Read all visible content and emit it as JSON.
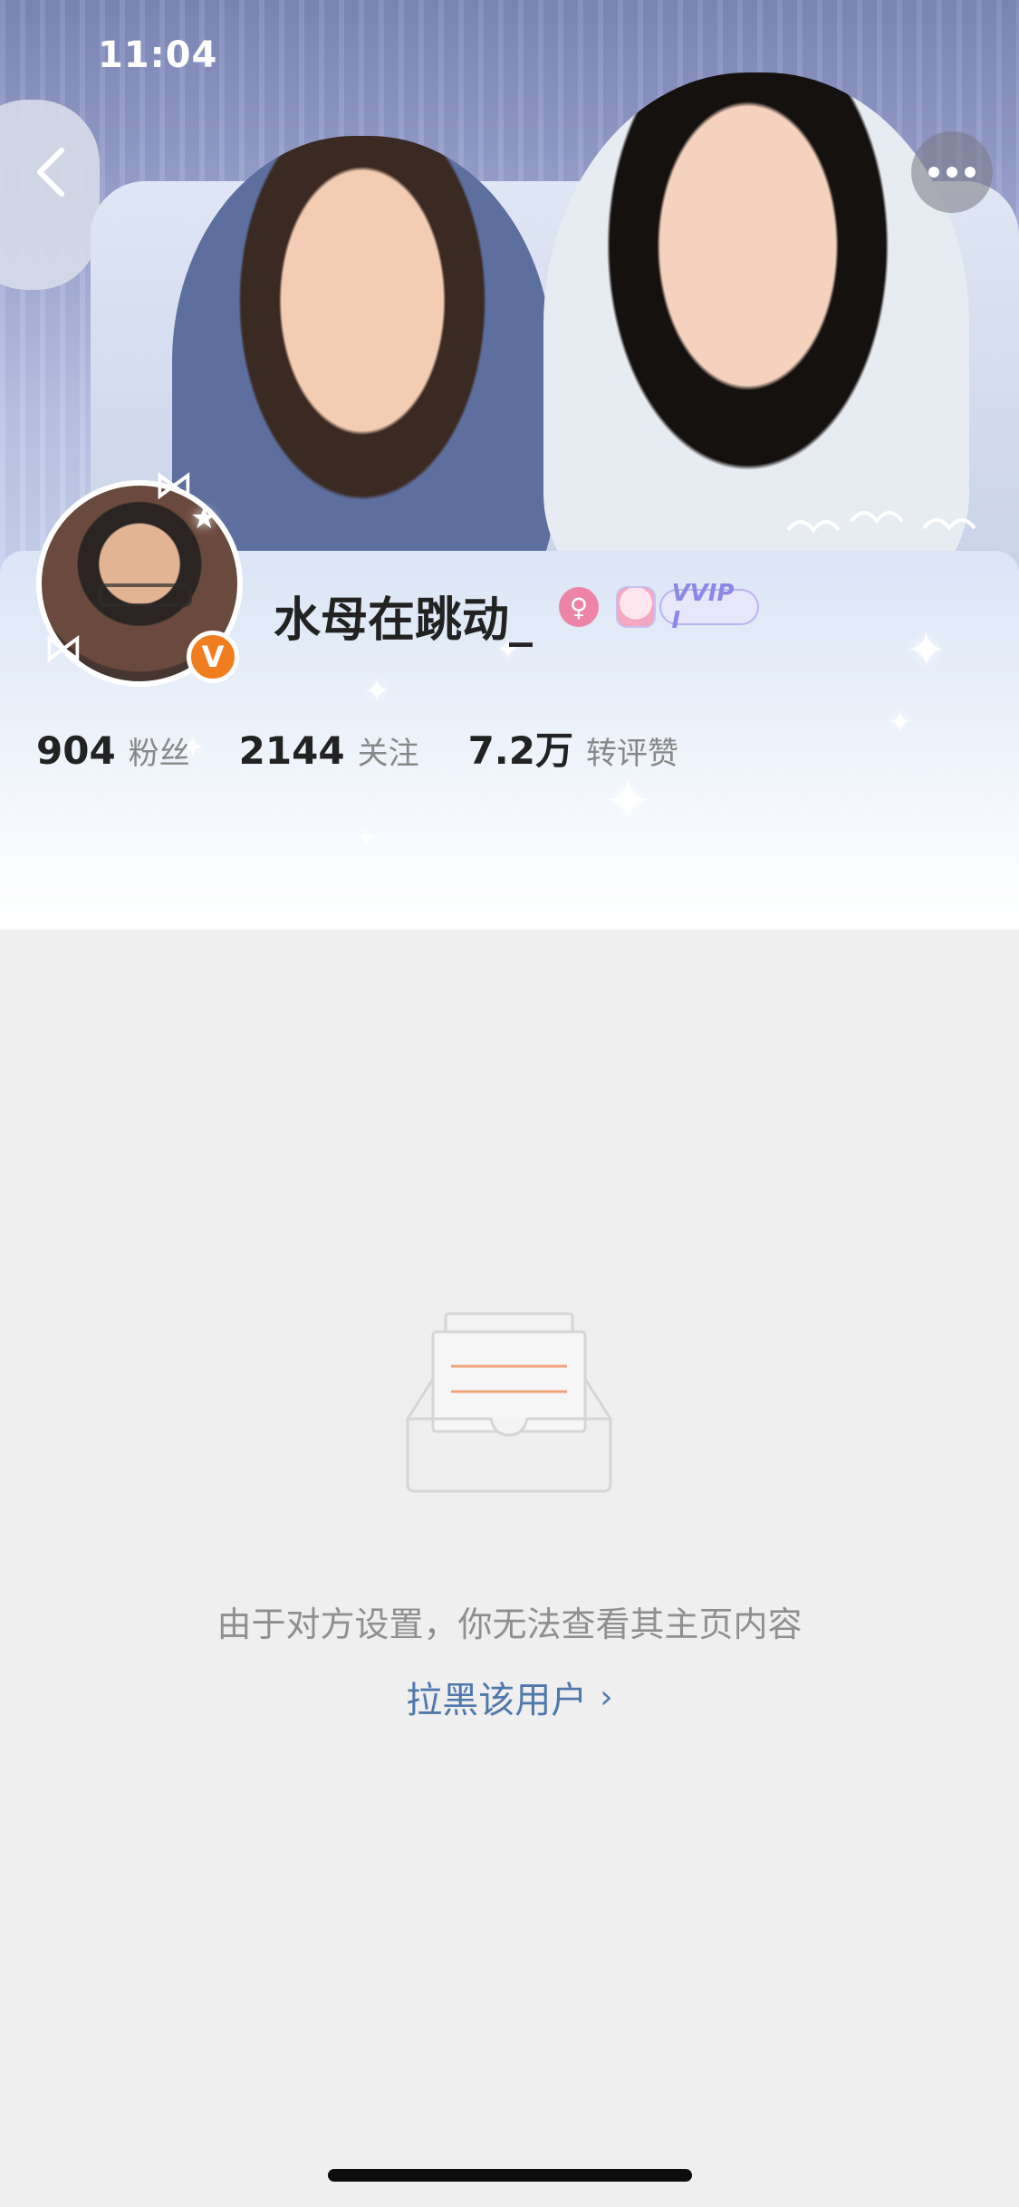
{
  "status_bar": {
    "time": "11:04"
  },
  "nav": {
    "back_icon": "chevron-left-icon",
    "more_icon": "ellipsis-icon"
  },
  "profile": {
    "username": "水母在跳动_",
    "verified_badge": "V",
    "gender_icon": "female-icon",
    "vip_label": "VVIP I",
    "stats": [
      {
        "value": "904",
        "label": "粉丝"
      },
      {
        "value": "2144",
        "label": "关注"
      },
      {
        "value": "7.2万",
        "label": "转评赞"
      }
    ]
  },
  "empty_state": {
    "icon": "empty-box-icon",
    "message": "由于对方设置，你无法查看其主页内容",
    "block_link": "拉黑该用户",
    "block_chevron": "›"
  },
  "colors": {
    "accent_link": "#4f79ad",
    "verified_orange": "#f07d1e",
    "gender_pink": "#ee83a8",
    "background": "#efefef"
  }
}
